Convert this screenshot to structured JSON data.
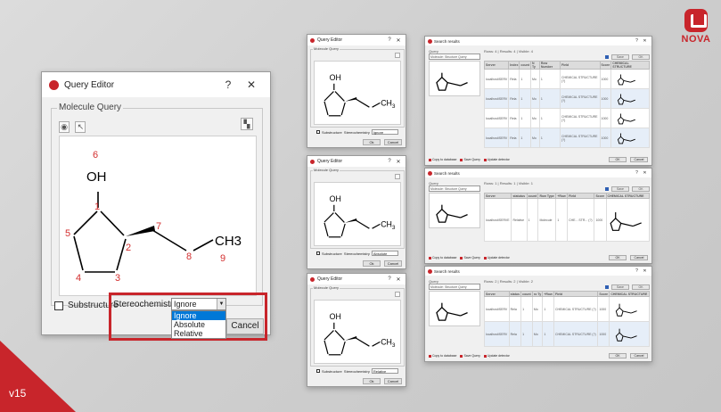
{
  "brand": {
    "name": "NOVA",
    "icon": "nova-logo-icon",
    "accent": "#c8252b"
  },
  "version": "v15",
  "main_dialog": {
    "title": "Query Editor",
    "help": "?",
    "close": "✕",
    "group_label": "Molecule Query",
    "tools": {
      "view": "eye-icon",
      "select": "pointer-icon",
      "export": "export-icon"
    },
    "molecule": {
      "atoms": {
        "oh": "OH",
        "ch3": "CH3"
      },
      "labels": [
        "6",
        "1",
        "2",
        "3",
        "4",
        "5",
        "7",
        "8",
        "9"
      ]
    },
    "substructure_label": "Substructure",
    "stereochemistry_label": "Stereochemistry:",
    "stereo_value": "Ignore",
    "stereo_options": [
      "Ignore",
      "Absolute",
      "Relative"
    ],
    "cancel": "Cancel"
  },
  "small_editors": [
    {
      "title": "Query Editor",
      "group_label": "Molecule Query",
      "substructure_label": "Substructure",
      "stereo_label": "Stereochemistry",
      "stereo_value": "Ignore",
      "ok": "Ok",
      "cancel": "Cancel"
    },
    {
      "title": "Query Editor",
      "group_label": "Molecule Query",
      "substructure_label": "Substructure",
      "stereo_label": "Stereochemistry",
      "stereo_value": "Absolute",
      "ok": "Ok",
      "cancel": "Cancel"
    },
    {
      "title": "Query Editor",
      "group_label": "Molecule Query",
      "substructure_label": "Substructure",
      "stereo_label": "Stereochemistry",
      "stereo_value": "Relative",
      "ok": "Ok",
      "cancel": "Cancel"
    }
  ],
  "search_results": [
    {
      "title": "Search results",
      "query_label": "Query",
      "query_value": "Molecule: Structure Query",
      "meta": "Rows: 4 | Results: 4 | Visible: 4",
      "save": "Save",
      "ok": "OK",
      "headers": [
        "Server",
        "Index",
        "count",
        "N Ty",
        "Row Number",
        "Field",
        "Score",
        "CHEMICAL STRUCTURE"
      ],
      "rows": [
        [
          "localhost\\SERV",
          "Rela",
          "1",
          "Mo",
          "1",
          "CHEMICAL STRUCTURE (?)",
          "1000",
          ""
        ],
        [
          "localhost\\SERV",
          "Rela",
          "1",
          "Mo",
          "1",
          "CHEMICAL STRUCTURE (?)",
          "1000",
          ""
        ],
        [
          "localhost\\SERV",
          "Rela",
          "1",
          "Mo",
          "1",
          "CHEMICAL STRUCTURE (?)",
          "1000",
          ""
        ],
        [
          "localhost\\SERV",
          "Rela",
          "1",
          "Mo",
          "1",
          "CHEMICAL STRUCTURE (?)",
          "1000",
          ""
        ]
      ],
      "status": [
        "Copy to database",
        "Save Query",
        "Update detector"
      ],
      "bottom_ok": "OK",
      "bottom_cancel": "Cancel"
    },
    {
      "title": "Search results",
      "query_label": "Query",
      "query_value": "Molecule: Structure Query",
      "meta": "Rows: 1 | Results: 1 | Visible: 1",
      "save": "Save",
      "ok": "OK",
      "headers": [
        "Server",
        "statutus",
        "count",
        "Row Type",
        "+Row",
        "Field",
        "Score",
        "CHEMICAL STRUCTURE"
      ],
      "rows": [
        [
          "localhost\\SERVE",
          "Relative",
          "1",
          "Molecule",
          "1",
          "CHE... STR... (?)",
          "1000",
          ""
        ]
      ],
      "status": [
        "Copy to database",
        "Save Query",
        "Update detector"
      ],
      "bottom_ok": "OK",
      "bottom_cancel": "Cancel"
    },
    {
      "title": "Search results",
      "query_label": "Query",
      "query_value": "Molecule: Structure Query",
      "meta": "Rows: 2 | Results: 2 | Visible: 2",
      "save": "Save",
      "ok": "OK",
      "headers": [
        "Server",
        "status",
        "count",
        "ro Ty",
        "+Row",
        "Field",
        "Score",
        "CHEMICAL STRUCTURE"
      ],
      "rows": [
        [
          "localhost\\SERV",
          "Rela",
          "1",
          "Mo",
          "1",
          "CHEMICAL STRUCTURE (?)",
          "1000",
          ""
        ],
        [
          "localhost\\SERV",
          "Rela",
          "1",
          "Mo",
          "1",
          "CHEMICAL STRUCTURE (?)",
          "1000",
          ""
        ]
      ],
      "status": [
        "Copy to database",
        "Save Query",
        "Update detector"
      ],
      "bottom_ok": "OK",
      "bottom_cancel": "Cancel"
    }
  ]
}
